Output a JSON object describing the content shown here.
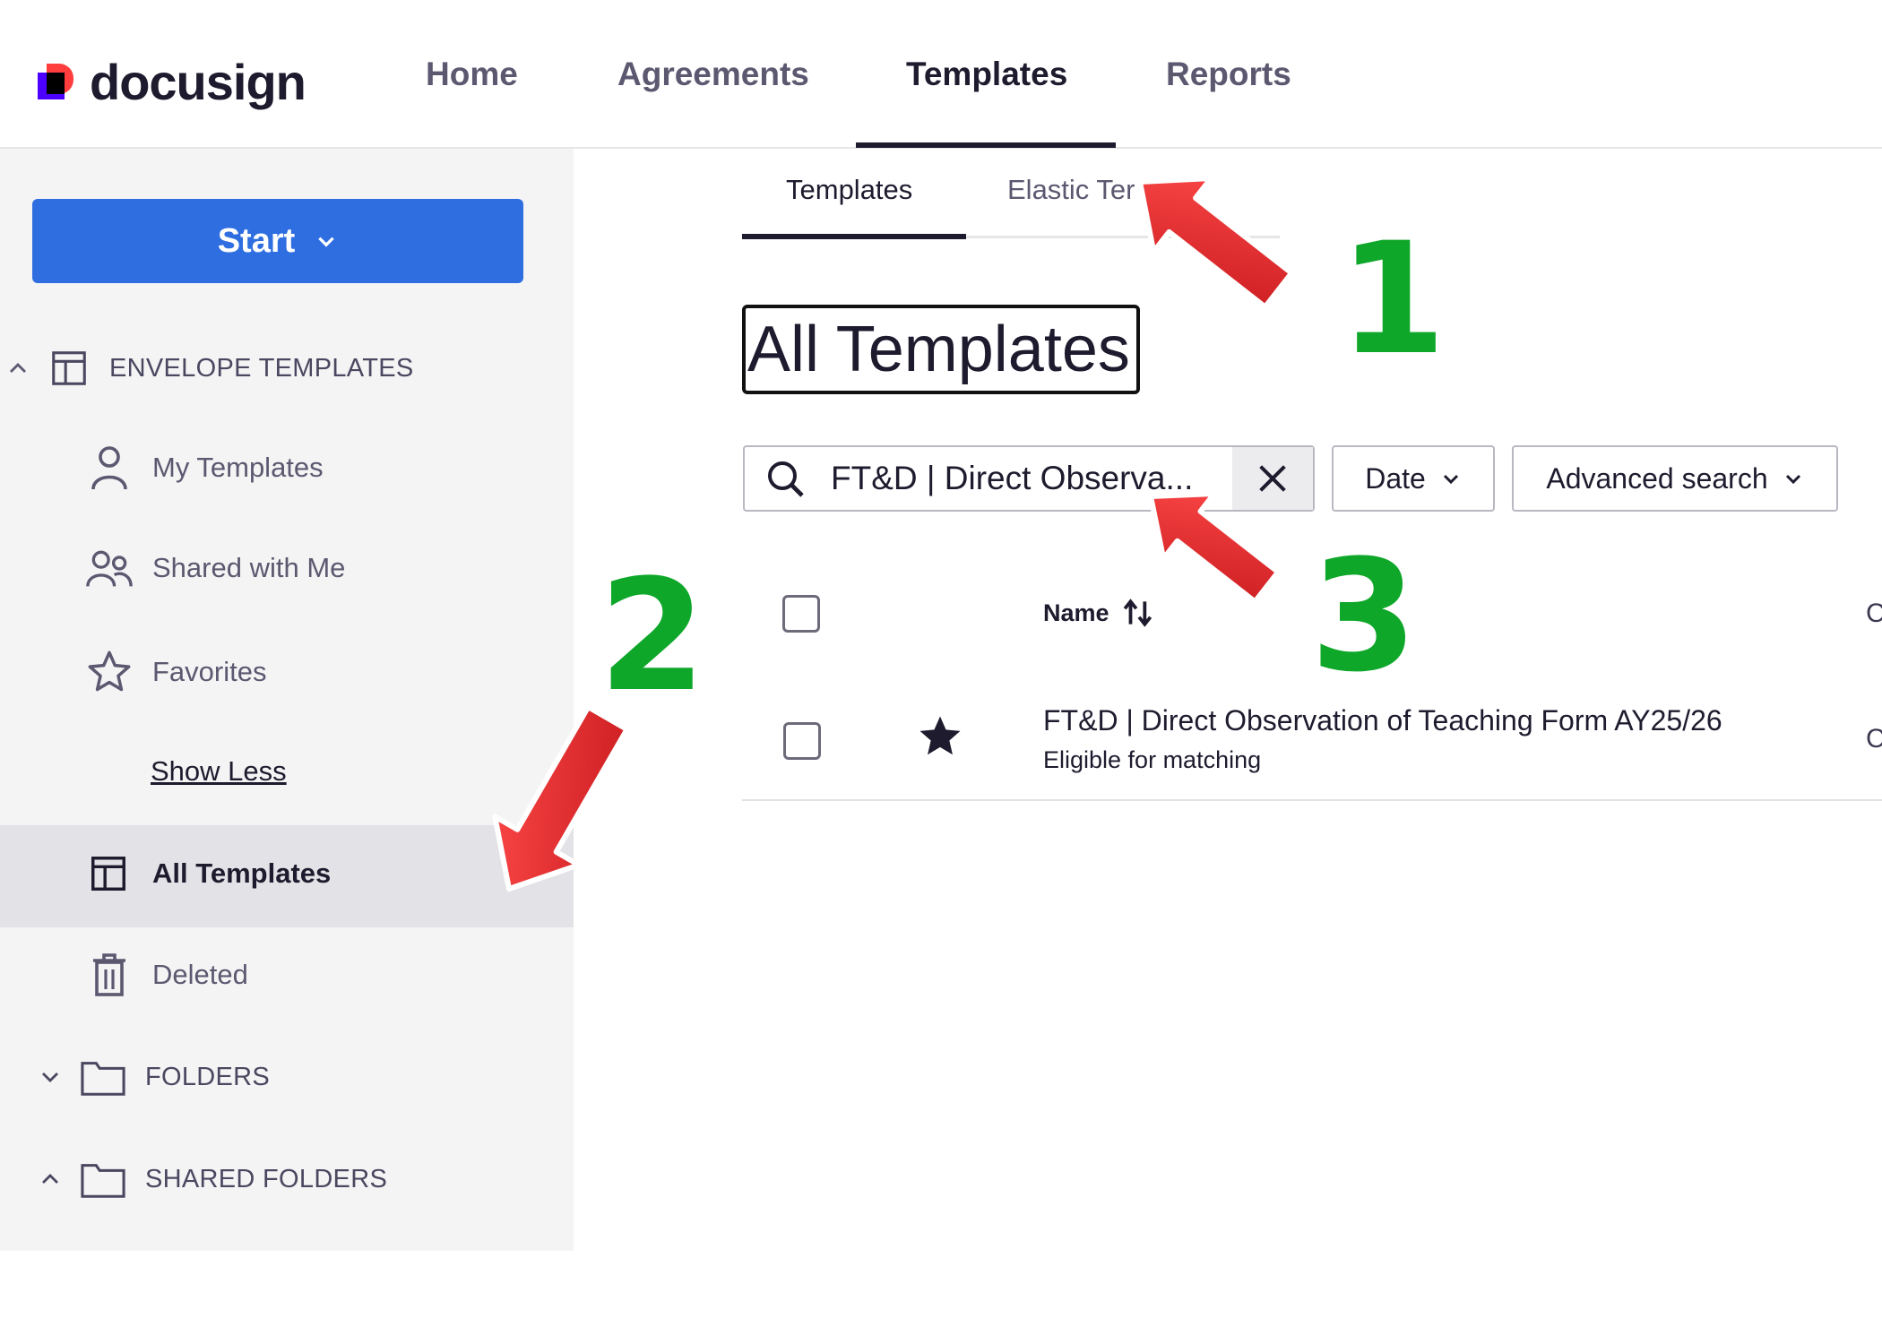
{
  "header": {
    "logo_text": "docusign",
    "nav": [
      {
        "label": "Home"
      },
      {
        "label": "Agreements"
      },
      {
        "label": "Templates"
      },
      {
        "label": "Reports"
      }
    ],
    "active_nav": "Templates"
  },
  "sidebar": {
    "start_label": "Start",
    "section_envelope": "ENVELOPE TEMPLATES",
    "items": [
      {
        "label": "My Templates",
        "icon": "person-icon"
      },
      {
        "label": "Shared with Me",
        "icon": "people-icon"
      },
      {
        "label": "Favorites",
        "icon": "star-outline-icon"
      }
    ],
    "show_less": "Show Less",
    "all_templates": "All Templates",
    "deleted": "Deleted",
    "folders": "FOLDERS",
    "shared_folders": "SHARED FOLDERS"
  },
  "main": {
    "subtabs": [
      {
        "label": "Templates"
      },
      {
        "label": "Elastic Ter"
      }
    ],
    "page_title": "All Templates",
    "search": {
      "value": "FT&D | Direct Observa..."
    },
    "date_filter": "Date",
    "advanced_search": "Advanced search",
    "table": {
      "col_name": "Name",
      "rows": [
        {
          "title": "FT&D | Direct Observation of Teaching Form AY25/26",
          "subtitle": "Eligible for matching",
          "favorite": true
        }
      ]
    }
  },
  "annotations": {
    "labels": [
      "1",
      "2",
      "3"
    ],
    "number_color": "#0fa72a",
    "arrow_color": "#e8282c"
  },
  "colors": {
    "primary_button": "#2e6ee0",
    "text_dark": "#1e1b2e",
    "sidebar_bg": "#f4f4f4"
  }
}
